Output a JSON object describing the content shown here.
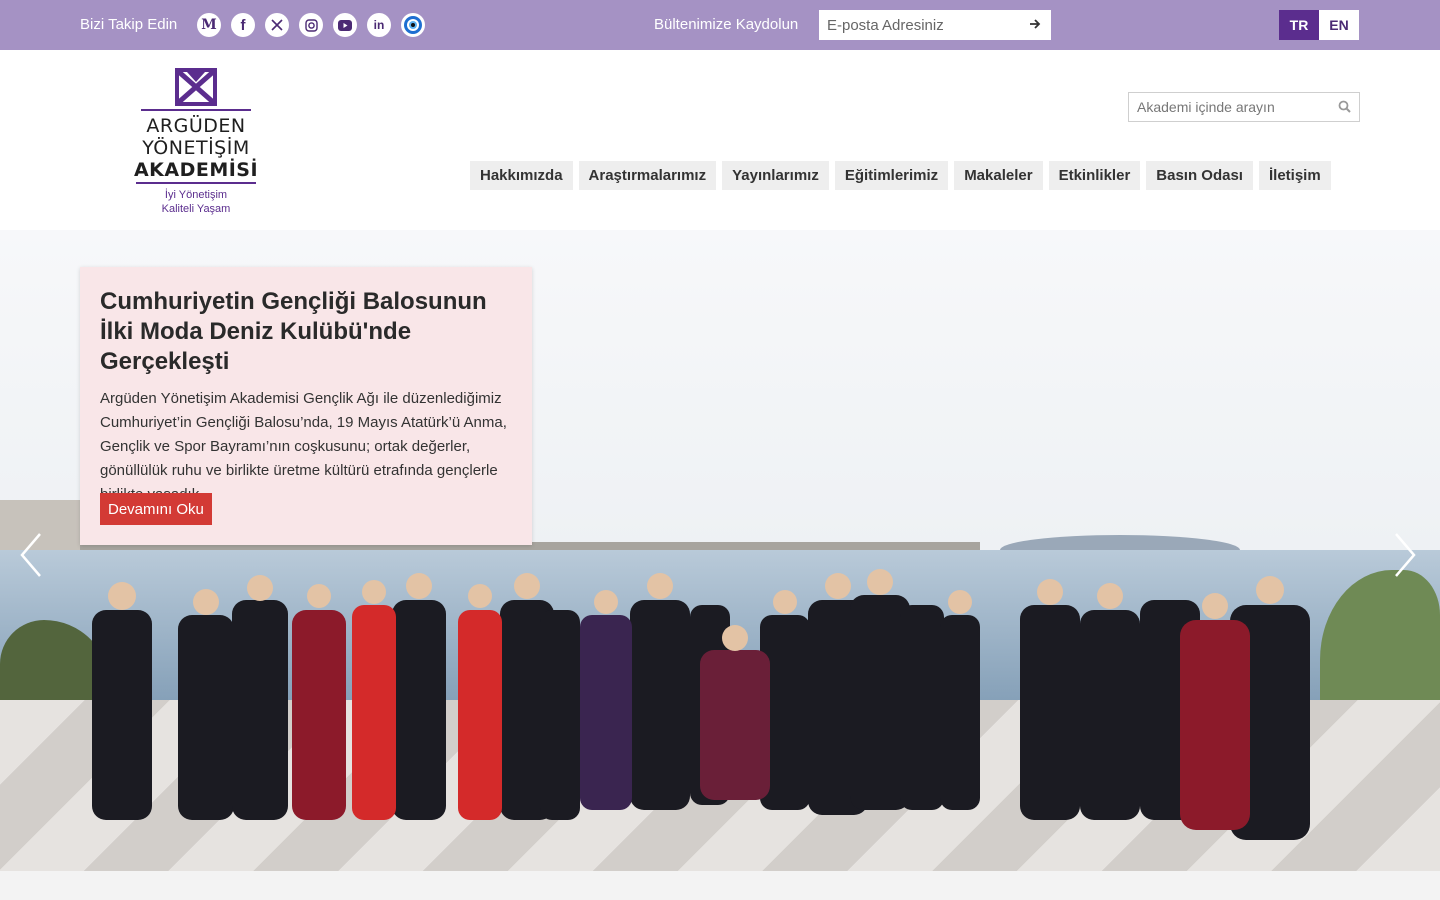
{
  "topbar": {
    "follow_label": "Bizi Takip Edin",
    "socials": [
      {
        "icon": "medium-icon",
        "glyph": "M"
      },
      {
        "icon": "facebook-icon",
        "glyph": "f"
      },
      {
        "icon": "x-twitter-icon",
        "glyph": "𝕏"
      },
      {
        "icon": "instagram-icon",
        "glyph": ""
      },
      {
        "icon": "youtube-icon",
        "glyph": ""
      },
      {
        "icon": "linkedin-icon",
        "glyph": "in"
      },
      {
        "icon": "eye-icon",
        "glyph": ""
      }
    ],
    "newsletter_label": "Bültenimize Kaydolun",
    "newsletter_placeholder": "E-posta Adresiniz",
    "lang_tr": "TR",
    "lang_en": "EN"
  },
  "header": {
    "logo_line1": "ARGÜDEN",
    "logo_line2": "YÖNETİŞİM",
    "logo_line3": "AKADEMİSİ",
    "tagline1": "İyi Yönetişim",
    "tagline2": "Kaliteli Yaşam",
    "search_placeholder": "Akademi içinde arayın"
  },
  "nav": {
    "items": [
      "Hakkımızda",
      "Araştırmalarımız",
      "Yayınlarımız",
      "Eğitimlerimiz",
      "Makaleler",
      "Etkinlikler",
      "Basın Odası",
      "İletişim"
    ]
  },
  "slide": {
    "title": "Cumhuriyetin Gençliği Balosunun İlki Moda Deniz Kulübü'nde Gerçekleşti",
    "text": "Argüden Yönetişim Akademisi Gençlik Ağı ile düzenlediğimiz Cumhuriyet’in Gençliği Balosu’nda, 19 Mayıs Atatürk’ü Anma, Gençlik ve Spor Bayramı’nın coşkusunu; ortak değerler, gönüllülük ruhu ve birlikte üretme kültürü etrafında gençlerle birlikte yaşadık.",
    "button": "Devamını Oku"
  },
  "colors": {
    "brand_purple": "#5b2d8e",
    "topbar_purple": "#a592c4",
    "card_pink": "#f9e6e8",
    "button_red": "#d33a35"
  }
}
